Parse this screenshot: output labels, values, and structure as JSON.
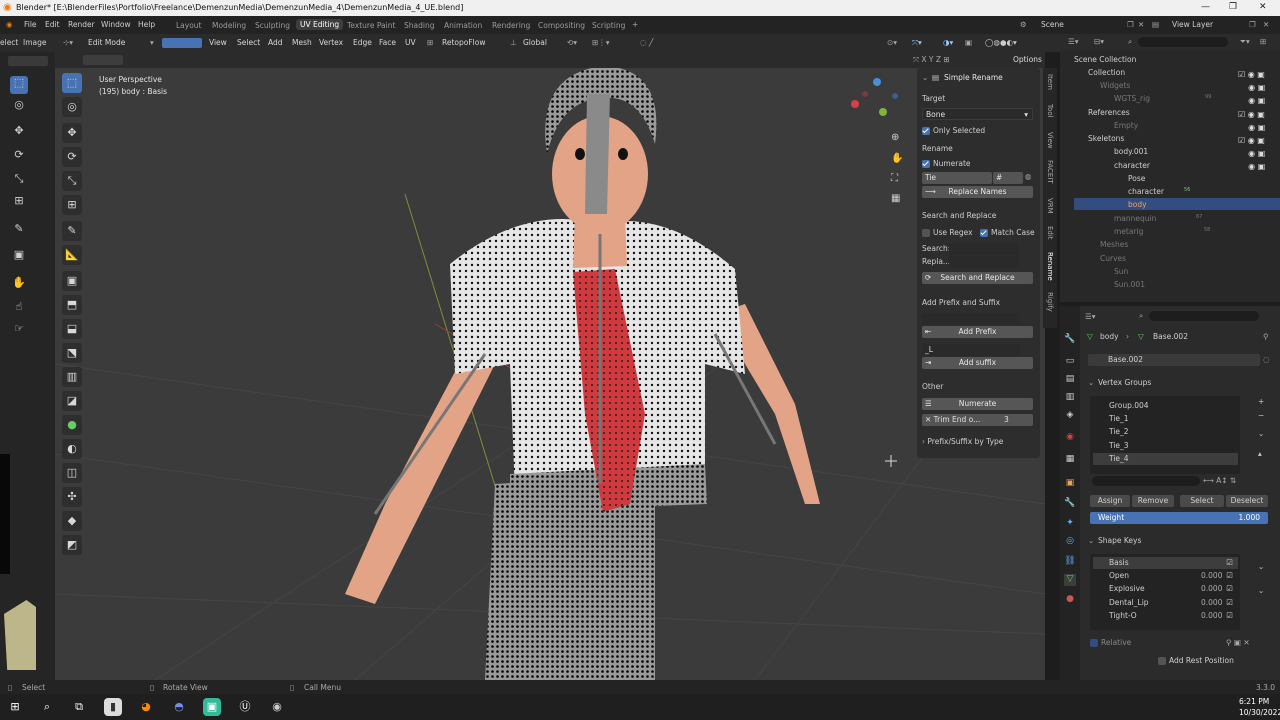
{
  "window": {
    "title": "Blender* [E:\\BlenderFiles\\Portfolio\\Freelance\\DemenzunMedia\\DemenzunMedia_4\\DemenzunMedia_4_UE.blend]"
  },
  "menu": {
    "items": [
      "File",
      "Edit",
      "Render",
      "Window",
      "Help"
    ],
    "workspaces": [
      "Layout",
      "Modeling",
      "Sculpting",
      "UV Editing",
      "Texture Paint",
      "Shading",
      "Animation",
      "Rendering",
      "Compositing",
      "Scripting"
    ],
    "active_workspace": "UV Editing",
    "scene": "Scene",
    "view_layer": "View Layer"
  },
  "left_pane": {
    "select_label": "elect",
    "image_label": "Image"
  },
  "viewport": {
    "mode": "Edit Mode",
    "header_items": [
      "View",
      "Select",
      "Add",
      "Mesh",
      "Vertex",
      "Edge",
      "Face",
      "UV"
    ],
    "retopoflow": "RetopoFlow",
    "orientation": "Global",
    "perspective": "User Perspective",
    "object_info": "(195) body : Basis",
    "options": "Options"
  },
  "npanel": {
    "title": "Simple Rename",
    "target_label": "Target",
    "target_value": "Bone",
    "only_selected": "Only Selected",
    "rename_label": "Rename",
    "numerate": "Numerate",
    "rename_value": "Tie",
    "hash": "#",
    "replace_names": "Replace Names",
    "search_replace_label": "Search and Replace",
    "use_regex": "Use Regex",
    "match_case": "Match Case",
    "search_label": "Search:",
    "replace_label": "Repla...",
    "search_replace_btn": "Search and Replace",
    "prefix_suffix_label": "Add Prefix and Suffix",
    "add_prefix": "Add Prefix",
    "suffix_value": "_L",
    "add_suffix": "Add suffix",
    "other_label": "Other",
    "numerate_btn": "Numerate",
    "trim_label": "Trim End o...",
    "trim_value": "3",
    "prefix_by_type": "Prefix/Suffix by Type"
  },
  "sidetabs": [
    "Item",
    "Tool",
    "View",
    "FACEIT",
    "VRM",
    "Edit",
    "Rename",
    "Rigify"
  ],
  "outliner": {
    "root": "Scene Collection",
    "items": [
      {
        "label": "Collection",
        "depth": 0
      },
      {
        "label": "Widgets",
        "depth": 1
      },
      {
        "label": "WGTS_rig",
        "depth": 2
      },
      {
        "label": "References",
        "depth": 0
      },
      {
        "label": "Empty",
        "depth": 1
      },
      {
        "label": "Skeletons",
        "depth": 0
      },
      {
        "label": "body.001",
        "depth": 1
      },
      {
        "label": "character",
        "depth": 1
      },
      {
        "label": "Pose",
        "depth": 2
      },
      {
        "label": "character",
        "depth": 2
      },
      {
        "label": "body",
        "depth": 2
      },
      {
        "label": "mannequin",
        "depth": 1
      },
      {
        "label": "metarig",
        "depth": 1
      },
      {
        "label": "Meshes",
        "depth": 0
      },
      {
        "label": "Curves",
        "depth": 0
      },
      {
        "label": "Sun",
        "depth": 1
      },
      {
        "label": "Sun.001",
        "depth": 1
      }
    ],
    "badges": {
      "wgts": "99",
      "mannequin": "67",
      "metarig": "58",
      "character": "56"
    }
  },
  "properties": {
    "object": "body",
    "mesh": "Base.002",
    "mesh_field": "Base.002",
    "vertex_groups_label": "Vertex Groups",
    "vertex_groups": [
      "Group.004",
      "Tie_1",
      "Tie_2",
      "Tie_3",
      "Tie_4"
    ],
    "assign": "Assign",
    "remove": "Remove",
    "select": "Select",
    "deselect": "Deselect",
    "weight_label": "Weight",
    "weight_value": "1.000",
    "shape_keys_label": "Shape Keys",
    "shape_keys": [
      {
        "name": "Basis",
        "value": ""
      },
      {
        "name": "Open",
        "value": "0.000"
      },
      {
        "name": "Explosive",
        "value": "0.000"
      },
      {
        "name": "Dental_Lip",
        "value": "0.000"
      },
      {
        "name": "Tight-O",
        "value": "0.000"
      }
    ],
    "relative": "Relative",
    "add_rest": "Add Rest Position"
  },
  "status": {
    "select": "Select",
    "rotate": "Rotate View",
    "call_menu": "Call Menu",
    "version": "3.3.0"
  },
  "taskbar": {
    "time": "6:21 PM",
    "date": "10/30/2022"
  },
  "colors": {
    "accent": "#4772b3",
    "tie": "#d8494f",
    "bg": "#3b3b3b"
  }
}
